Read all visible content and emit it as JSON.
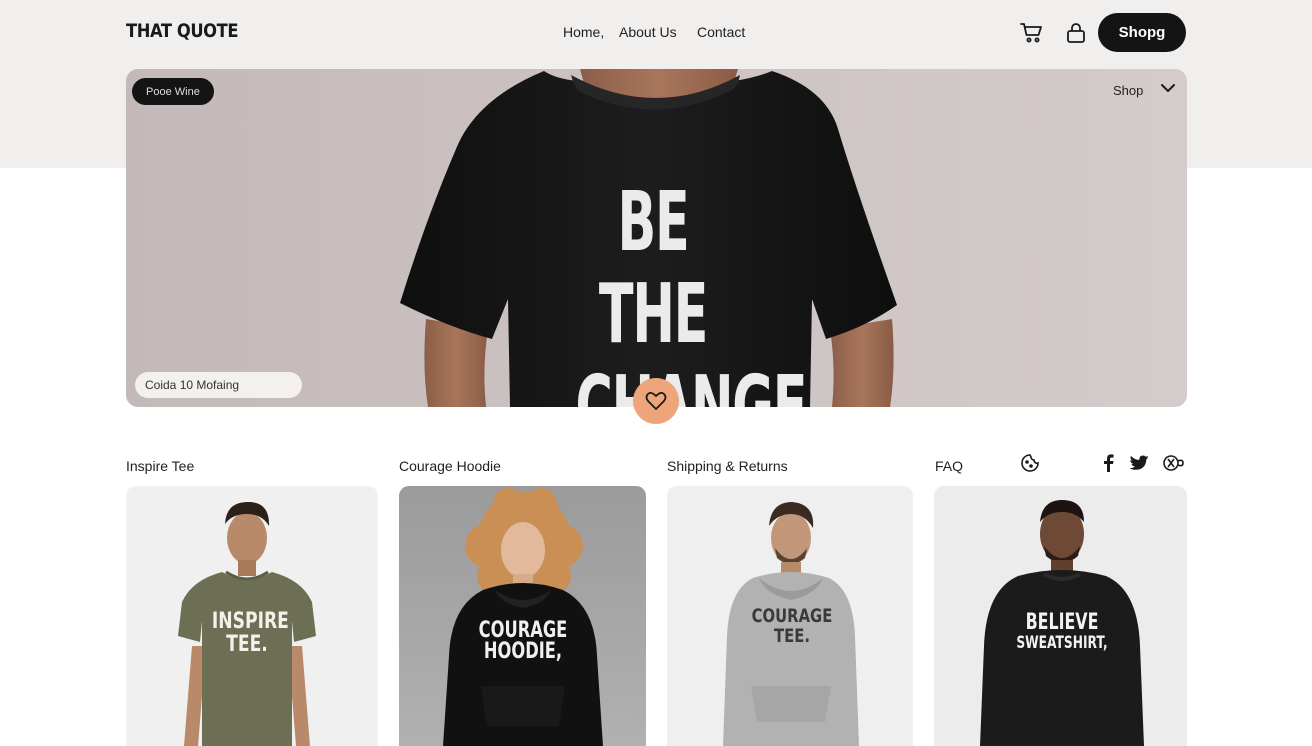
{
  "header": {
    "logo": "THAT QUOTE",
    "nav": {
      "home": "Home,",
      "about": "About Us",
      "contact": "Contact"
    },
    "icons": {
      "cart": "cart-icon",
      "bag": "lock-bag-icon"
    },
    "shop_button": "Shopg"
  },
  "hero": {
    "pill_label": "Pooe Wine",
    "shop_dropdown": "Shop",
    "shirt_text_line1": "BE THE",
    "shirt_text_line2": "CHANGE,",
    "search_label": "Coida 10 Mofaing",
    "favorite_icon": "heart-icon"
  },
  "categories": {
    "item1": "Inspire Tee",
    "item2": "Courage Hoodie",
    "item3": "Shipping & Returns",
    "item4": "FAQ"
  },
  "social_icons": [
    "cookie-icon",
    "facebook-icon",
    "twitter-icon",
    "share-icon"
  ],
  "products": [
    {
      "print_line1": "INSPIRE",
      "print_line2": "TEE."
    },
    {
      "print_line1": "COURAGE",
      "print_line2": "HOODIE,"
    },
    {
      "print_line1": "COURAGE",
      "print_line2": "TEE."
    },
    {
      "print_line1": "BELIEVE",
      "print_line2": "SWEATSHIRT,"
    }
  ],
  "colors": {
    "accent_dark": "#141414",
    "heart_button": "#efa57a",
    "header_band": "#f1efee"
  }
}
